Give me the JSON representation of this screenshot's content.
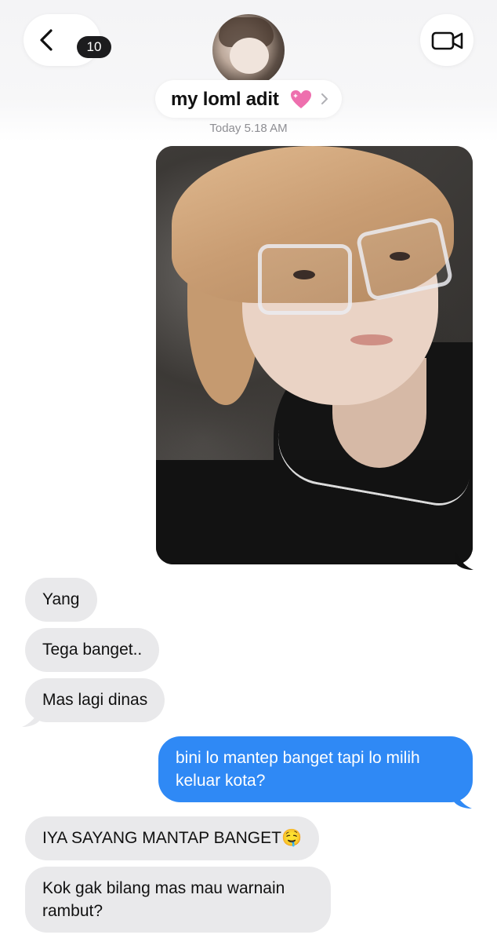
{
  "header": {
    "unread_count": "10",
    "contact_name": "my loml adit",
    "contact_emoji": "💗",
    "timestamp": "Today 5.18 AM"
  },
  "messages": [
    {
      "direction": "outgoing",
      "type": "image",
      "description_icon": "photo-attachment"
    },
    {
      "direction": "incoming",
      "text": "Yang"
    },
    {
      "direction": "incoming",
      "text": "Tega banget.."
    },
    {
      "direction": "incoming",
      "text": "Mas lagi dinas"
    },
    {
      "direction": "outgoing",
      "lines": [
        "bini lo mantep banget tapi lo milih",
        "keluar kota?"
      ]
    },
    {
      "direction": "incoming",
      "text": "IYA SAYANG MANTAP BANGET🤤"
    },
    {
      "direction": "incoming",
      "lines": [
        "Kok gak bilang mas mau warnain",
        "rambut?"
      ]
    }
  ],
  "colors": {
    "incoming_bubble": "#e9e9eb",
    "outgoing_bubble": "#2f89f5",
    "timestamp_text": "#8e8e93"
  }
}
